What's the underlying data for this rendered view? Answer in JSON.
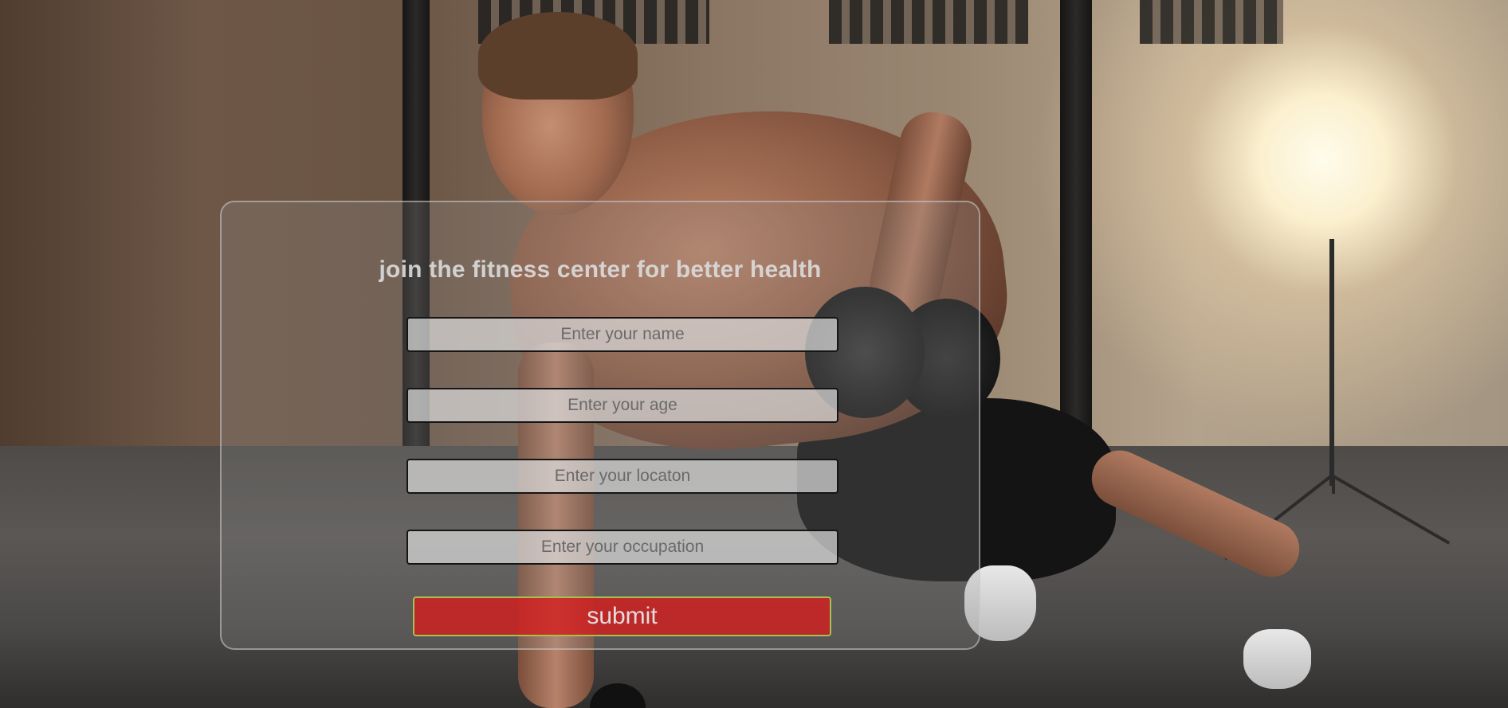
{
  "form": {
    "title": "join the fitness center for better health",
    "fields": {
      "name_placeholder": "Enter your name",
      "age_placeholder": "Enter your age",
      "location_placeholder": "Enter your locaton",
      "occupation_placeholder": "Enter your occupation"
    },
    "submit_label": "submit"
  },
  "colors": {
    "submit_background": "#d21e1e",
    "submit_border": "#a6c24e",
    "card_border": "#cdcdcd",
    "title_text": "#dadada"
  }
}
